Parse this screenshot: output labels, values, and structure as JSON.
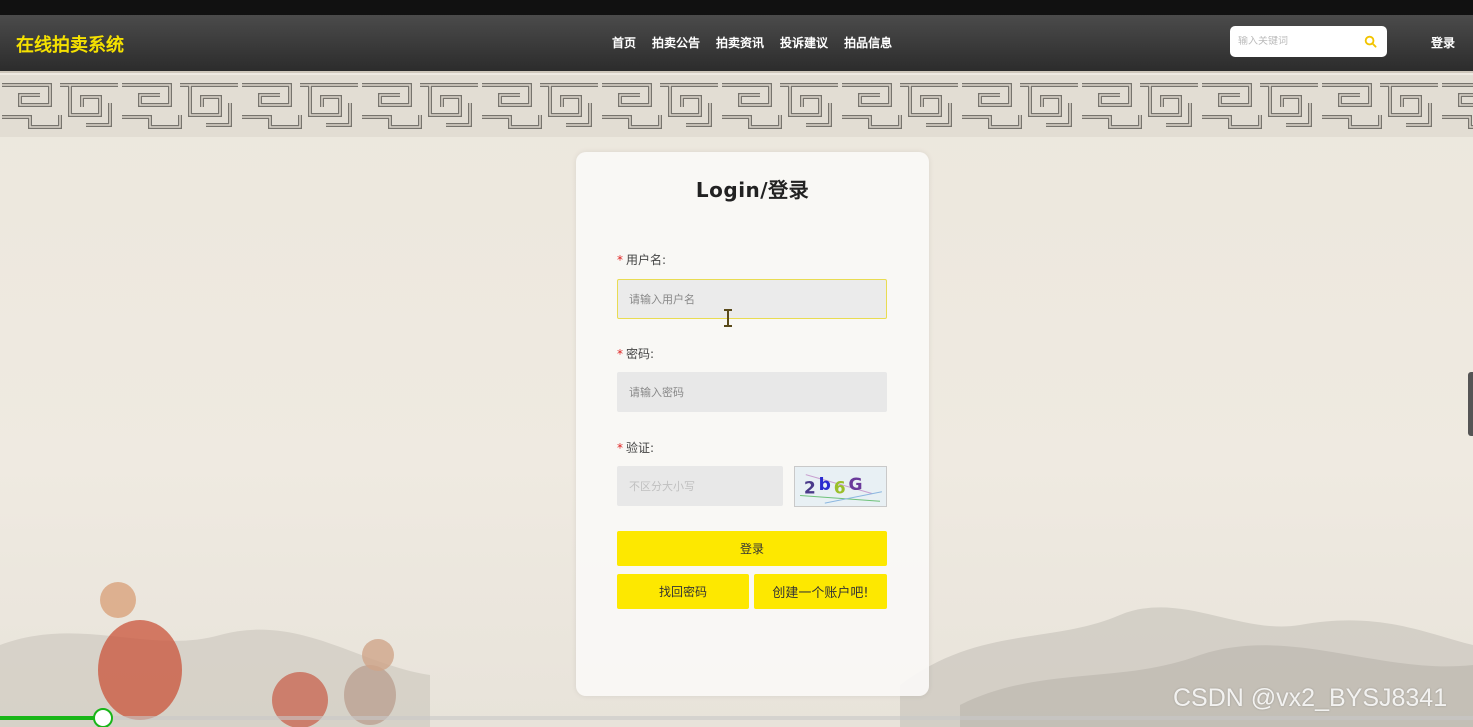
{
  "header": {
    "brand": "在线拍卖系统",
    "nav": [
      "首页",
      "拍卖公告",
      "拍卖资讯",
      "投诉建议",
      "拍品信息"
    ],
    "search_placeholder": "输入关键词",
    "login_label": "登录"
  },
  "login_form": {
    "title": "Login/登录",
    "required_mark": "*",
    "username_label": "用户名:",
    "username_placeholder": "请输入用户名",
    "password_label": "密码:",
    "password_placeholder": "请输入密码",
    "captcha_label": "验证:",
    "captcha_placeholder": "不区分大小写",
    "captcha_text": "2b6G",
    "login_button": "登录",
    "forgot_button": "找回密码",
    "register_button": "创建一个账户吧!"
  },
  "player": {
    "progress_fraction": 0.07
  },
  "watermark": "CSDN @vx2_BYSJ8341",
  "colors": {
    "accent_yellow": "#fde800",
    "brand_yellow": "#f5e100",
    "navbar": "#333333",
    "progress_green": "#18b618"
  },
  "icons": {
    "search": "search-icon",
    "cursor": "text-cursor-icon"
  }
}
